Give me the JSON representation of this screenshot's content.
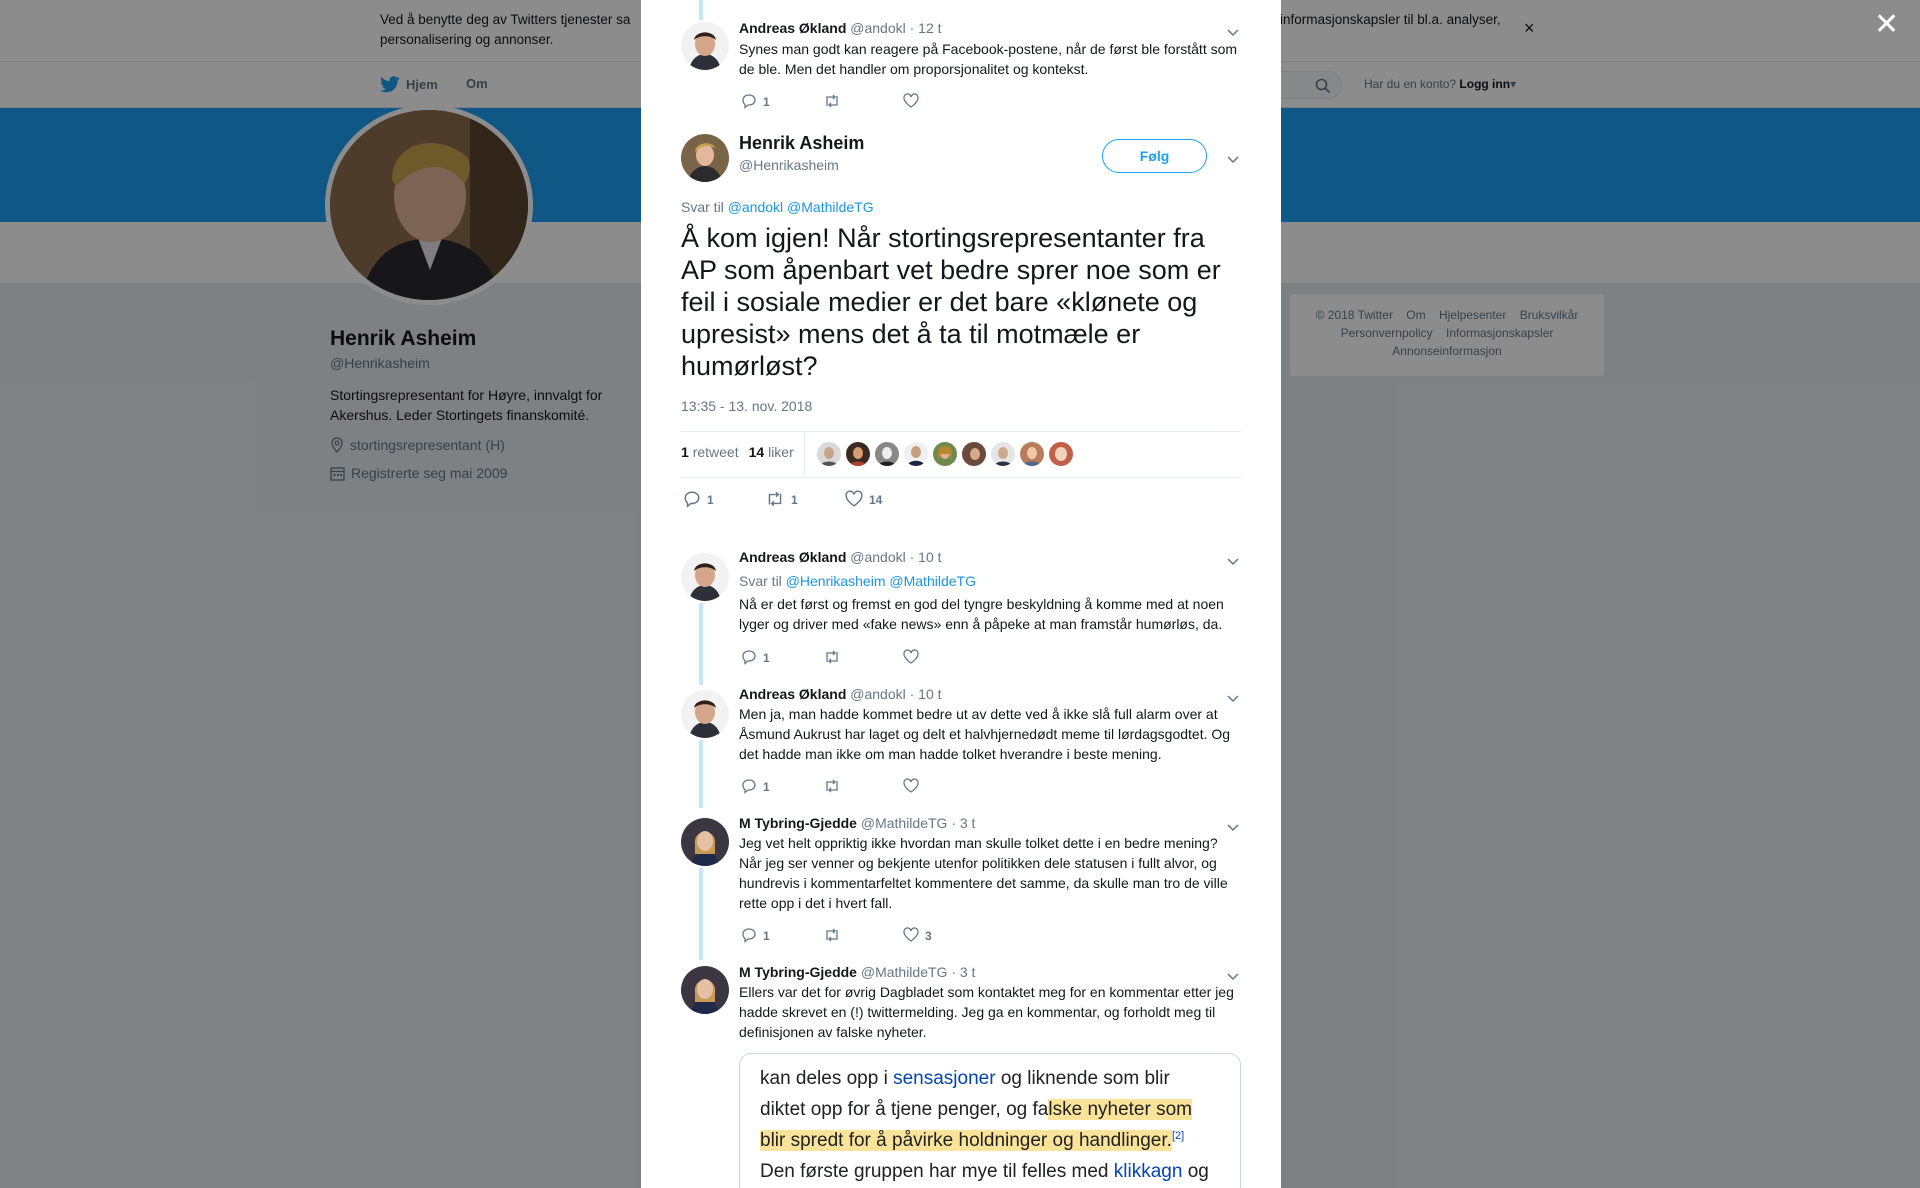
{
  "cookie_bar": {
    "text": "Ved å benytte deg av Twitters tjenester sa",
    "text_right": "informasjonskapsler til bl.a. analyser,",
    "text_line2": "personalisering og annonser."
  },
  "topnav": {
    "home_label": "Hjem",
    "about_label": "Om",
    "account_prompt": "Har du en konto?",
    "login_label": "Logg inn"
  },
  "profile": {
    "name": "Henrik Asheim",
    "handle": "@Henrikasheim",
    "bio": "Stortingsrepresentant for Høyre, innvalgt for Akershus. Leder Stortingets finanskomité.",
    "location": "stortingsrepresentant (H)",
    "joined": "Registrerte seg mai 2009"
  },
  "footer": {
    "links": [
      "© 2018 Twitter",
      "Om",
      "Hjelpesenter",
      "Bruksvilkår",
      "Personvernpolicy",
      "Informasjonskapsler",
      "Annonseinformasjon"
    ]
  },
  "modal": {
    "top_reply": {
      "name": "Andreas Økland",
      "handle": "@andokl",
      "time": "· 12 t",
      "text": "Synes man godt kan reagere på Facebook-postene, når de først ble forstått som de ble. Men det handler om proporsjonalitet og kontekst.",
      "reply_count": "1"
    },
    "main_tweet": {
      "name": "Henrik Asheim",
      "handle": "@Henrikasheim",
      "follow_label": "Følg",
      "reply_prefix": "Svar til",
      "reply_to_1": "@andokl",
      "reply_to_2": "@MathildeTG",
      "text": "Å kom igjen! Når stortingsrepresentanter fra AP som åpenbart vet bedre sprer noe som er feil i sosiale medier er det bare «klønete og upresist» mens det å ta til motmæle er humørløst?",
      "timestamp": "13:35 - 13. nov. 2018",
      "retweets_count": "1",
      "retweets_label": "retweet",
      "likes_count": "14",
      "likes_label": "liker",
      "reply_count": "1",
      "retweet_action_count": "1",
      "like_action_count": "14"
    },
    "replies": [
      {
        "name": "Andreas Økland",
        "handle": "@andokl",
        "time": "· 10 t",
        "reply_prefix": "Svar til",
        "reply_to_1": "@Henrikasheim",
        "reply_to_2": "@MathildeTG",
        "text": "Nå er det først og fremst en god del tyngre beskyldning å komme med at noen lyger og driver med «fake news» enn å påpeke at man framstår humørløs, da.",
        "reply_count": "1",
        "like_count": ""
      },
      {
        "name": "Andreas Økland",
        "handle": "@andokl",
        "time": "· 10 t",
        "text": "Men ja, man hadde kommet bedre ut av dette ved å ikke slå full alarm over at Åsmund Aukrust har laget og delt et halvhjernedødt meme til lørdagsgodtet. Og det hadde man ikke om man hadde tolket hverandre i beste mening.",
        "reply_count": "1",
        "like_count": ""
      },
      {
        "name": "M Tybring-Gjedde",
        "handle": "@MathildeTG",
        "time": "· 3 t",
        "text": "Jeg vet helt oppriktig ikke hvordan man skulle tolket dette i en bedre mening? Når jeg ser venner og bekjente utenfor politikken dele statusen i fullt alvor, og hundrevis i kommentarfeltet kommentere det samme, da skulle man tro de ville rette opp i det i hvert fall.",
        "reply_count": "1",
        "like_count": "3"
      },
      {
        "name": "M Tybring-Gjedde",
        "handle": "@MathildeTG",
        "time": "· 3 t",
        "text": "Ellers var det for øvrig Dagbladet som kontaktet meg for en kommentar etter jeg hadde skrevet en (!) twittermelding. Jeg ga en kommentar, og forholdt meg til definisjonen av falske nyheter.",
        "reply_count": "",
        "like_count": ""
      }
    ],
    "embed": {
      "l1a": "kan deles opp i ",
      "l1b": "sensasjoner",
      "l1c": " og liknende som blir",
      "l2a": "diktet opp for å tjene penger, og fa",
      "l2b": "lske nyheter som",
      "l3a": "blir spredt for å påvirke holdninger og handlinger.",
      "l3b": "[2]",
      "l4a": "Den første gruppen har mye til felles med ",
      "l4b": "klikkagn",
      "l4c": " og"
    }
  },
  "colors": {
    "accent": "#1da1f2",
    "link": "#1b95e0",
    "thread_line": "#c4e6fb",
    "highlight": "#fbe49a"
  }
}
